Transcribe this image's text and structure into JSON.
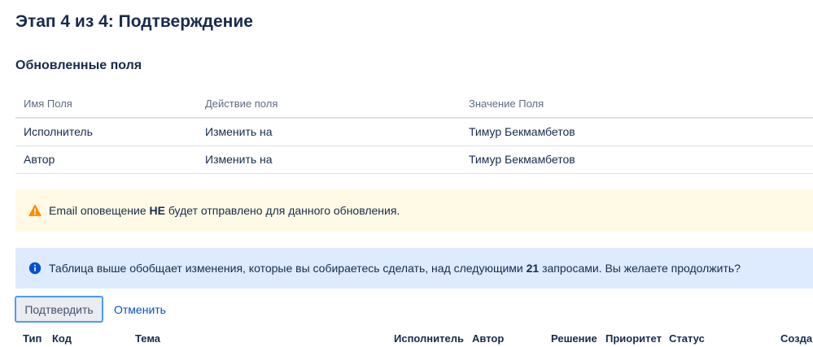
{
  "header": {
    "step_title": "Этап 4 из 4: Подтверждение"
  },
  "updated_fields": {
    "title": "Обновленные поля",
    "columns": [
      "Имя Поля",
      "Действие поля",
      "Значение Поля"
    ],
    "rows": [
      [
        "Исполнитель",
        "Изменить на",
        "Тимур Бекмамбетов"
      ],
      [
        "Автор",
        "Изменить на",
        "Тимур Бекмамбетов"
      ]
    ]
  },
  "warning": {
    "icon": "warning-icon",
    "color": "#ff8b00",
    "text_before": "Email оповещение ",
    "text_bold": "НЕ",
    "text_after": " будет отправлено для данного обновления."
  },
  "info": {
    "icon": "info-icon",
    "color": "#0052cc",
    "text_before": "Таблица выше обобщает изменения, которые вы собираетесь сделать, над следующими ",
    "count": "21",
    "text_after": " запросами. Вы желаете продолжить?"
  },
  "actions": {
    "confirm_label": "Подтвердить",
    "cancel_label": "Отменить"
  },
  "issues_table": {
    "columns": {
      "type": "Тип",
      "key": "Код",
      "summary": "Тема",
      "assignee": "Исполнитель",
      "reporter": "Автор",
      "resolution": "Решение",
      "priority": "Приоритет",
      "status": "Статус",
      "created": "Создан"
    }
  }
}
